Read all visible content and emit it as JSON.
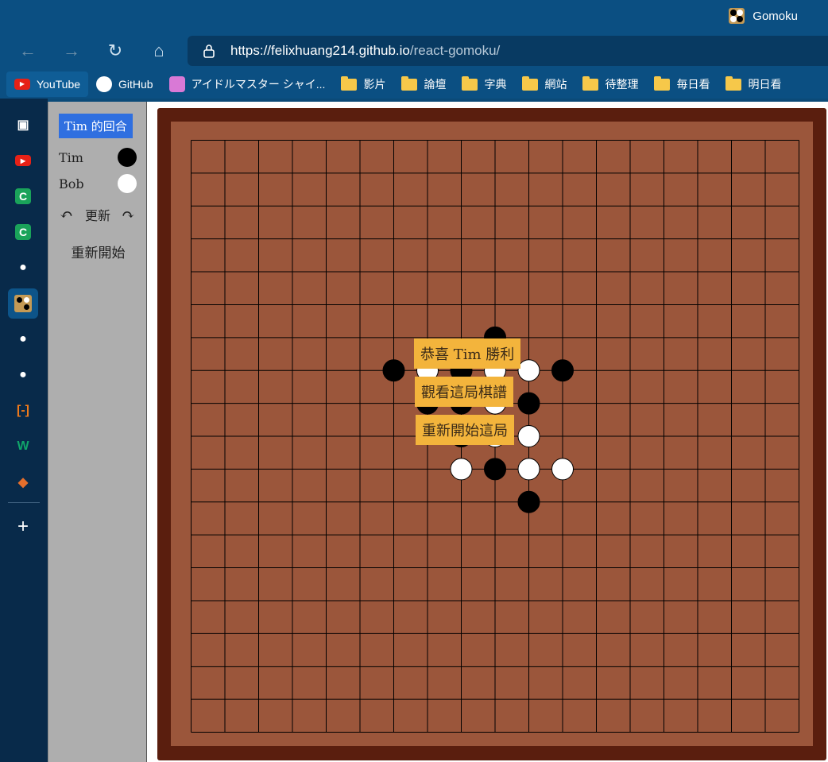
{
  "window": {
    "title": "Gomoku"
  },
  "browser": {
    "url_host": "https://felixhuang214.github.io",
    "url_path": "/react-gomoku/"
  },
  "bookmarks": [
    {
      "label": "YouTube",
      "icon": "youtube-icon"
    },
    {
      "label": "GitHub",
      "icon": "github-icon"
    },
    {
      "label": "アイドルマスター シャイ...",
      "icon": "idolmaster-icon"
    },
    {
      "label": "影片",
      "icon": "folder-icon"
    },
    {
      "label": "論壇",
      "icon": "folder-icon"
    },
    {
      "label": "字典",
      "icon": "folder-icon"
    },
    {
      "label": "網站",
      "icon": "folder-icon"
    },
    {
      "label": "待整理",
      "icon": "folder-icon"
    },
    {
      "label": "毎日看",
      "icon": "folder-icon"
    },
    {
      "label": "明日看",
      "icon": "folder-icon"
    }
  ],
  "sidebar": {
    "items": [
      {
        "icon": "tab-overview-icon",
        "glyph": "▣"
      },
      {
        "icon": "youtube-icon",
        "glyph": "▶"
      },
      {
        "icon": "c-app-icon",
        "glyph": "C"
      },
      {
        "icon": "c-app-icon",
        "glyph": "C"
      },
      {
        "icon": "github-icon",
        "glyph": "●"
      },
      {
        "icon": "gomoku-icon",
        "glyph": ""
      },
      {
        "icon": "github-icon",
        "glyph": "●"
      },
      {
        "icon": "github-icon",
        "glyph": "●"
      },
      {
        "icon": "bracket-app-icon",
        "glyph": "[-]"
      },
      {
        "icon": "w3-icon",
        "glyph": "W"
      },
      {
        "icon": "orange-app-icon",
        "glyph": "◆"
      }
    ],
    "add": "+"
  },
  "game": {
    "turn_label": "Tim 的回合",
    "players": [
      {
        "name": "Tim",
        "stone": "black"
      },
      {
        "name": "Bob",
        "stone": "white"
      }
    ],
    "undo": "↶",
    "refresh": "更新",
    "redo": "↷",
    "restart": "重新開始",
    "popup": {
      "win": "恭喜 Tim 勝利",
      "review": "觀看這局棋譜",
      "restart": "重新開始這局"
    }
  },
  "colors": {
    "board": "#9b563b",
    "frame": "#5a1e0e",
    "accent": "#2f6fe0",
    "popup": "#f3b43c"
  },
  "board": {
    "size": 18,
    "stones": [
      {
        "col": 9,
        "row": 6,
        "color": "black"
      },
      {
        "col": 6,
        "row": 7,
        "color": "black"
      },
      {
        "col": 7,
        "row": 7,
        "color": "white"
      },
      {
        "col": 8,
        "row": 7,
        "color": "black"
      },
      {
        "col": 9,
        "row": 7,
        "color": "white"
      },
      {
        "col": 10,
        "row": 7,
        "color": "white"
      },
      {
        "col": 11,
        "row": 7,
        "color": "black"
      },
      {
        "col": 7,
        "row": 8,
        "color": "black"
      },
      {
        "col": 8,
        "row": 8,
        "color": "black"
      },
      {
        "col": 9,
        "row": 8,
        "color": "white"
      },
      {
        "col": 10,
        "row": 8,
        "color": "black"
      },
      {
        "col": 8,
        "row": 9,
        "color": "black"
      },
      {
        "col": 9,
        "row": 9,
        "color": "white"
      },
      {
        "col": 10,
        "row": 9,
        "color": "white"
      },
      {
        "col": 8,
        "row": 10,
        "color": "white"
      },
      {
        "col": 9,
        "row": 10,
        "color": "black"
      },
      {
        "col": 10,
        "row": 10,
        "color": "white"
      },
      {
        "col": 11,
        "row": 10,
        "color": "white"
      },
      {
        "col": 10,
        "row": 11,
        "color": "black"
      }
    ]
  }
}
